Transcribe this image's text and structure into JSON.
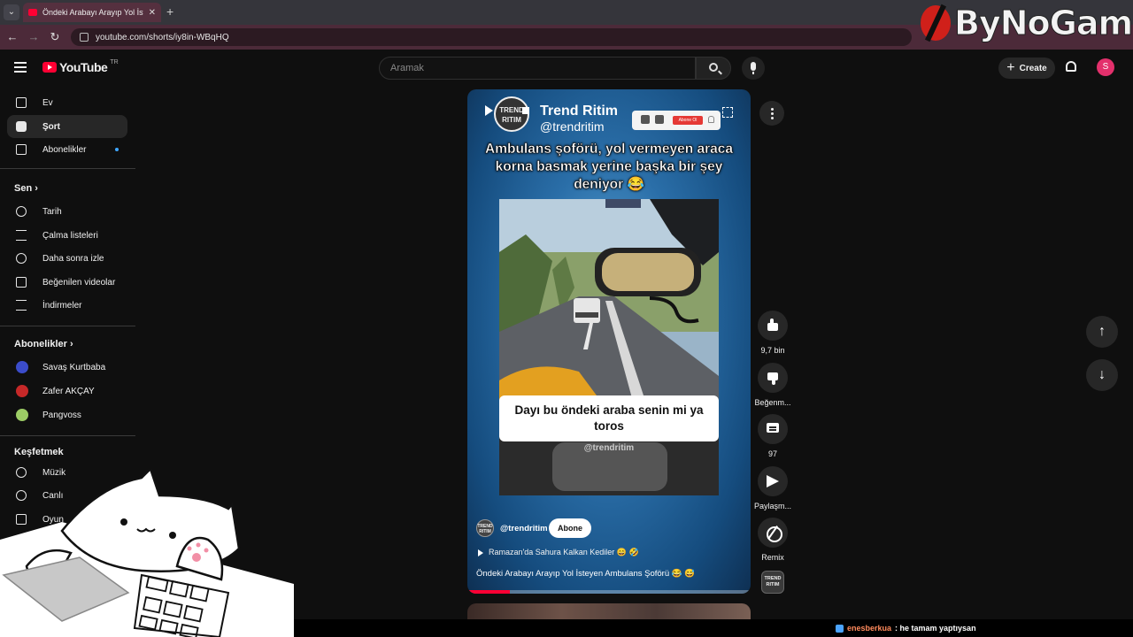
{
  "browser": {
    "tab_title": "Öndeki Arabayı Arayıp Yol İsteyen Ambulans Şoförü",
    "url": "youtube.com/shorts/iy8in-WBqHQ",
    "tab_close": "✕",
    "new_tab": "+",
    "tab_menu": "⌄",
    "back": "←",
    "forward": "→",
    "reload": "↻"
  },
  "watermark": {
    "brand": "ByNoGame"
  },
  "header": {
    "logo_text": "YouTube",
    "country": "TR",
    "search_placeholder": "Aramak",
    "create_label": "Create",
    "create_plus": "+",
    "avatar_letter": "S"
  },
  "sidebar": {
    "main": [
      {
        "label": "Ev",
        "icon": "home-icon"
      },
      {
        "label": "Şort",
        "icon": "shorts-icon",
        "active": true
      },
      {
        "label": "Abonelikler",
        "icon": "subscriptions-icon"
      }
    ],
    "you_section": "Sen",
    "you_items": [
      {
        "label": "Tarih",
        "icon": "history-icon"
      },
      {
        "label": "Çalma listeleri",
        "icon": "playlists-icon"
      },
      {
        "label": "Daha sonra izle",
        "icon": "watch-later-icon"
      },
      {
        "label": "Beğenilen videolar",
        "icon": "liked-videos-icon"
      },
      {
        "label": "İndirmeler",
        "icon": "downloads-icon"
      }
    ],
    "subs_section": "Abonelikler",
    "channels": [
      {
        "name": "Savaş Kurtbaba",
        "color": "#3b4cca"
      },
      {
        "name": "Zafer AKÇAY",
        "color": "#c62828"
      },
      {
        "name": "Pangvoss",
        "color": "#9ccc65"
      }
    ],
    "explore_section": "Keşfetmek",
    "explore_items": [
      {
        "label": "Müzik",
        "icon": "music-icon"
      },
      {
        "label": "Canlı",
        "icon": "live-icon"
      },
      {
        "label": "Oyun",
        "icon": "gaming-icon"
      }
    ]
  },
  "short": {
    "overlay_brand_name": "Trend Ritim",
    "overlay_brand_handle": "@trendritim",
    "overlay_logo_text": "TREND RITIM",
    "overlay_subscribe": "Abone Ol",
    "headline": "Ambulans şoförü, yol vermeyen araca korna basmak yerine başka bir şey deniyor 😂",
    "caption": "Dayı bu öndeki araba senin mi ya toros",
    "video_watermark": "@trendritim",
    "channel_handle": "@trendritim",
    "subscribe_label": "Abone",
    "playlist": "Ramazan'da Sahura Kalkan Kediler 😄 🤣",
    "title": "Öndeki Arabayı Arayıp Yol İsteyen Ambulans Şoförü 😂 😅",
    "progress": 0.15
  },
  "actions": {
    "likes": "9,7 bin",
    "dislike": "Beğenm...",
    "comments": "97",
    "share": "Paylaşm...",
    "remix": "Remix"
  },
  "chat": {
    "user": "enesberkua",
    "message": ": he tamam yaptıysan"
  },
  "colors": {
    "accent": "#ff0033",
    "avatar": "#e3306c",
    "chat_user": "#ff8a5c"
  }
}
